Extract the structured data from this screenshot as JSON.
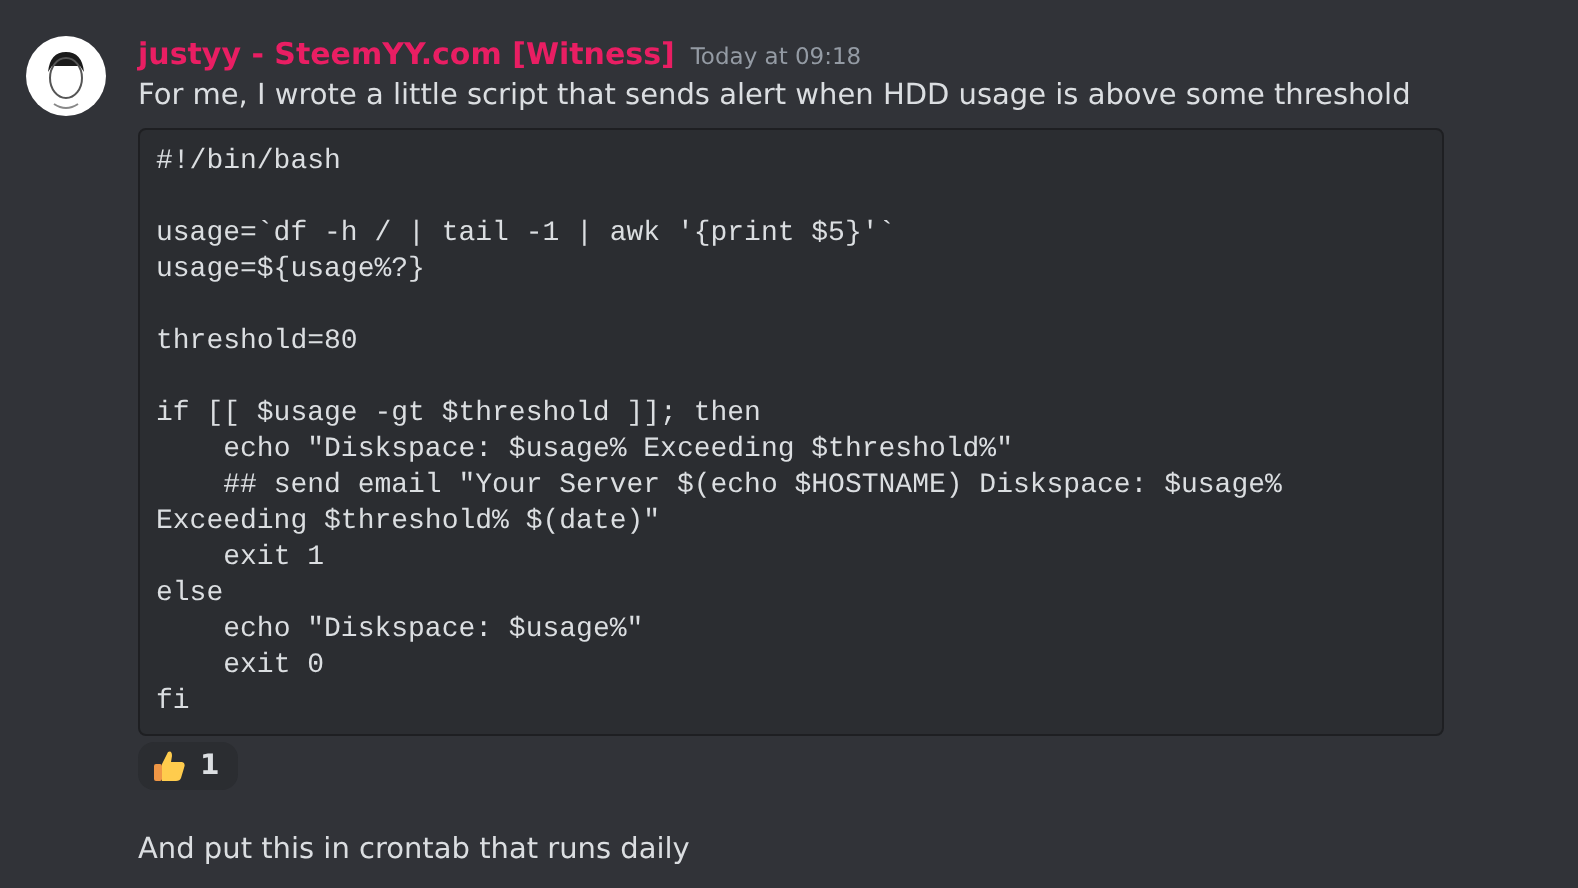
{
  "message": {
    "author": "justyy - SteemYY.com [Witness]",
    "timestamp": "Today at 09:18",
    "text": "For me, I wrote a little script that sends alert when HDD usage is above some threshold",
    "code": "#!/bin/bash\n\nusage=`df -h / | tail -1 | awk '{print $5}'`\nusage=${usage%?}\n\nthreshold=80\n\nif [[ $usage -gt $threshold ]]; then\n    echo \"Diskspace: $usage% Exceeding $threshold%\"\n    ## send email \"Your Server $(echo $HOSTNAME) Diskspace: $usage% Exceeding $threshold% $(date)\"\n    exit 1\nelse\n    echo \"Diskspace: $usage%\"\n    exit 0\nfi",
    "reactions": [
      {
        "count": "1",
        "selected": false
      }
    ]
  },
  "followup": {
    "text": "And put this in crontab that runs daily"
  }
}
